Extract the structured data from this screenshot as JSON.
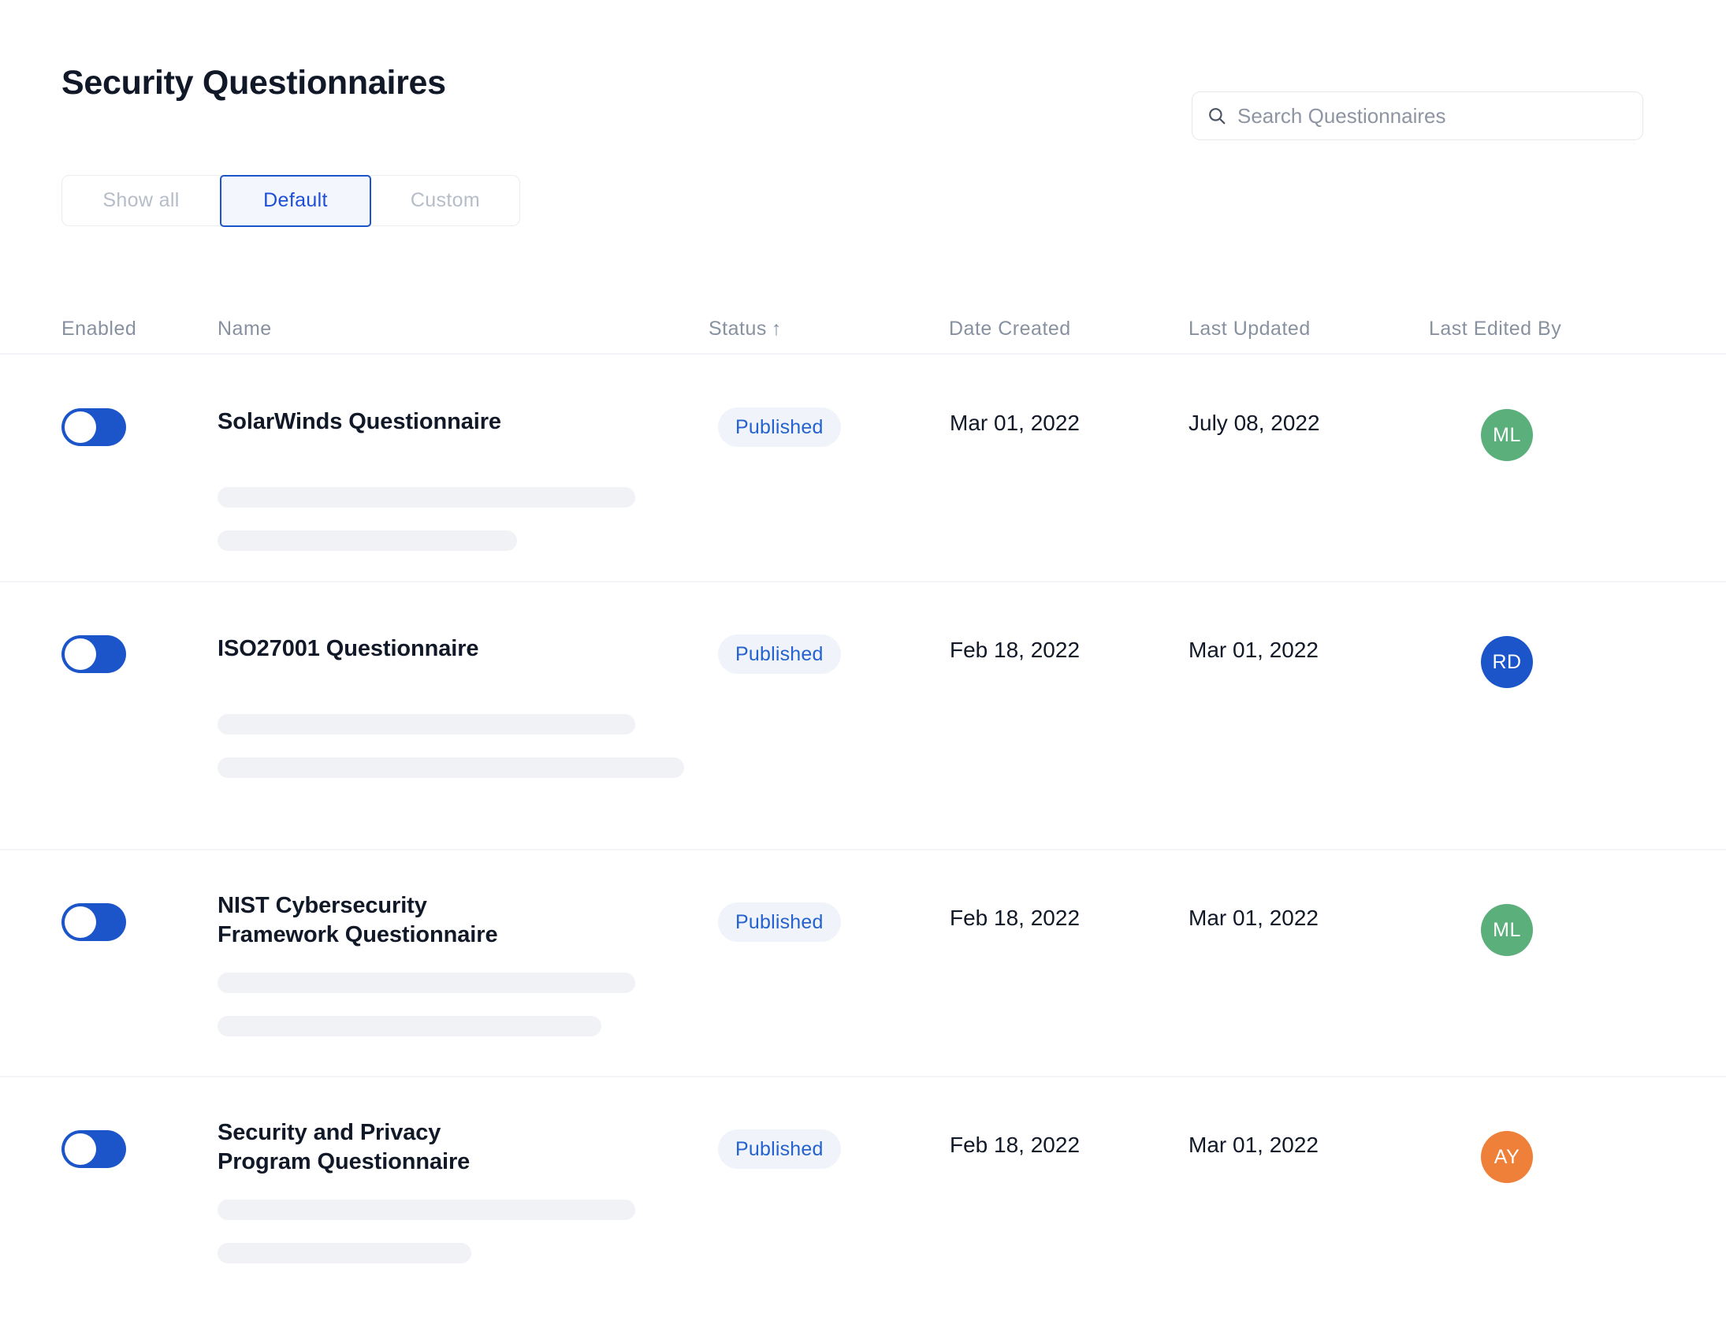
{
  "header": {
    "title": "Security Questionnaires"
  },
  "search": {
    "placeholder": "Search Questionnaires",
    "value": "",
    "icon": "search-icon"
  },
  "filters": {
    "options": [
      {
        "label": "Show all",
        "selected": false
      },
      {
        "label": "Default",
        "selected": true
      },
      {
        "label": "Custom",
        "selected": false
      }
    ]
  },
  "table": {
    "columns": [
      {
        "key": "enabled",
        "label": "Enabled",
        "sorted": false
      },
      {
        "key": "name",
        "label": "Name",
        "sorted": false
      },
      {
        "key": "status",
        "label": "Status",
        "sorted": true,
        "sort_arrow": "↑"
      },
      {
        "key": "date_created",
        "label": "Date Created",
        "sorted": false
      },
      {
        "key": "last_updated",
        "label": "Last Updated",
        "sorted": false
      },
      {
        "key": "last_edited_by",
        "label": "Last Edited By",
        "sorted": false
      }
    ],
    "rows": [
      {
        "enabled": true,
        "name": "SolarWinds Questionnaire",
        "name_line2": "",
        "status": "Published",
        "date_created": "Mar 01, 2022",
        "last_updated": "July 08, 2022",
        "last_edited_by": {
          "initials": "ML",
          "color": "#5BAF7A"
        }
      },
      {
        "enabled": true,
        "name": "ISO27001 Questionnaire",
        "name_line2": "",
        "status": "Published",
        "date_created": "Feb 18, 2022",
        "last_updated": "Mar 01, 2022",
        "last_edited_by": {
          "initials": "RD",
          "color": "#1B55C9"
        }
      },
      {
        "enabled": true,
        "name": "NIST Cybersecurity",
        "name_line2": "Framework Questionnaire",
        "status": "Published",
        "date_created": "Feb 18, 2022",
        "last_updated": "Mar 01, 2022",
        "last_edited_by": {
          "initials": "ML",
          "color": "#5BAF7A"
        }
      },
      {
        "enabled": true,
        "name": "Security and Privacy",
        "name_line2": "Program Questionnaire",
        "status": "Published",
        "date_created": "Feb 18, 2022",
        "last_updated": "Mar 01, 2022",
        "last_edited_by": {
          "initials": "AY",
          "color": "#EE8039"
        }
      }
    ]
  },
  "colors": {
    "accent": "#1B55C9",
    "badge_text": "#2463CE",
    "badge_bg": "#F0F3F9",
    "muted_text": "#8791A0",
    "skeleton": "#F1F2F6"
  }
}
